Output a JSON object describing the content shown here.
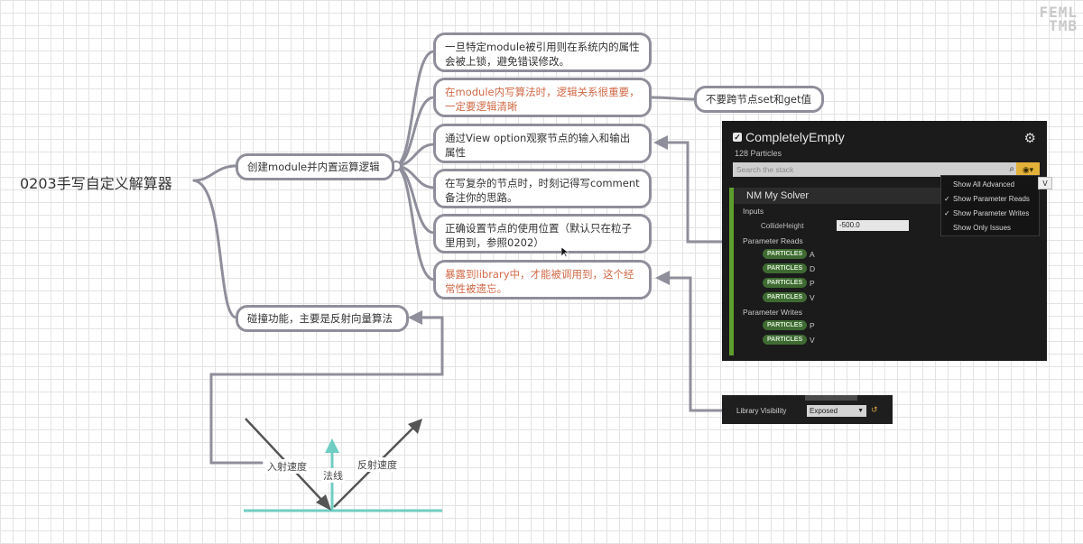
{
  "root": "0203手写自定义解算器",
  "branches": {
    "create": "创建module并内置运算逻辑",
    "collision": "碰撞功能，主要是反射向量算法"
  },
  "leaves": [
    "一旦特定module被引用则在系统内的属性会被上锁，避免错误修改。",
    "在module内写算法时，逻辑关系很重要，一定要逻辑清晰",
    "通过View option观察节点的输入和输出属性",
    "在写复杂的节点时，时刻记得写comment备注你的思路。",
    "正确设置节点的使用位置（默认只在粒子里用到，参照0202）",
    "暴露到library中，才能被调用到，这个经常性被遗忘。"
  ],
  "side_note": "不要跨节点set和get值",
  "corner_logo": "FEML\nTMB",
  "reflection": {
    "incident": "入射速度",
    "normal": "法线",
    "reflected": "反射速度"
  },
  "niagara": {
    "title": "CompletelyEmpty",
    "particles": "128 Particles",
    "search_placeholder": "Search the stack",
    "module": "NM My Solver",
    "inputs_label": "Inputs",
    "param_name": "CollideHeight",
    "param_value": "-500.0",
    "reads_label": "Parameter Reads",
    "writes_label": "Parameter Writes",
    "pill": "PARTICLES",
    "reads": [
      "A",
      "D",
      "P",
      "V"
    ],
    "writes": [
      "P",
      "V"
    ],
    "menu": [
      {
        "label": "Show All Advanced",
        "checked": false
      },
      {
        "label": "Show Parameter Reads",
        "checked": true
      },
      {
        "label": "Show Parameter Writes",
        "checked": true
      },
      {
        "label": "Show Only Issues",
        "checked": false
      }
    ],
    "tooltip": "V",
    "colors": {
      "accent_green": "#5e9e2c",
      "eye_button": "#e2b13a"
    }
  },
  "library": {
    "label": "Library Visibility",
    "value": "Exposed"
  },
  "colors": {
    "connector": "#8f8f9b",
    "highlight_text": "#d06a48",
    "normal_arrow": "#6fcdc3"
  }
}
